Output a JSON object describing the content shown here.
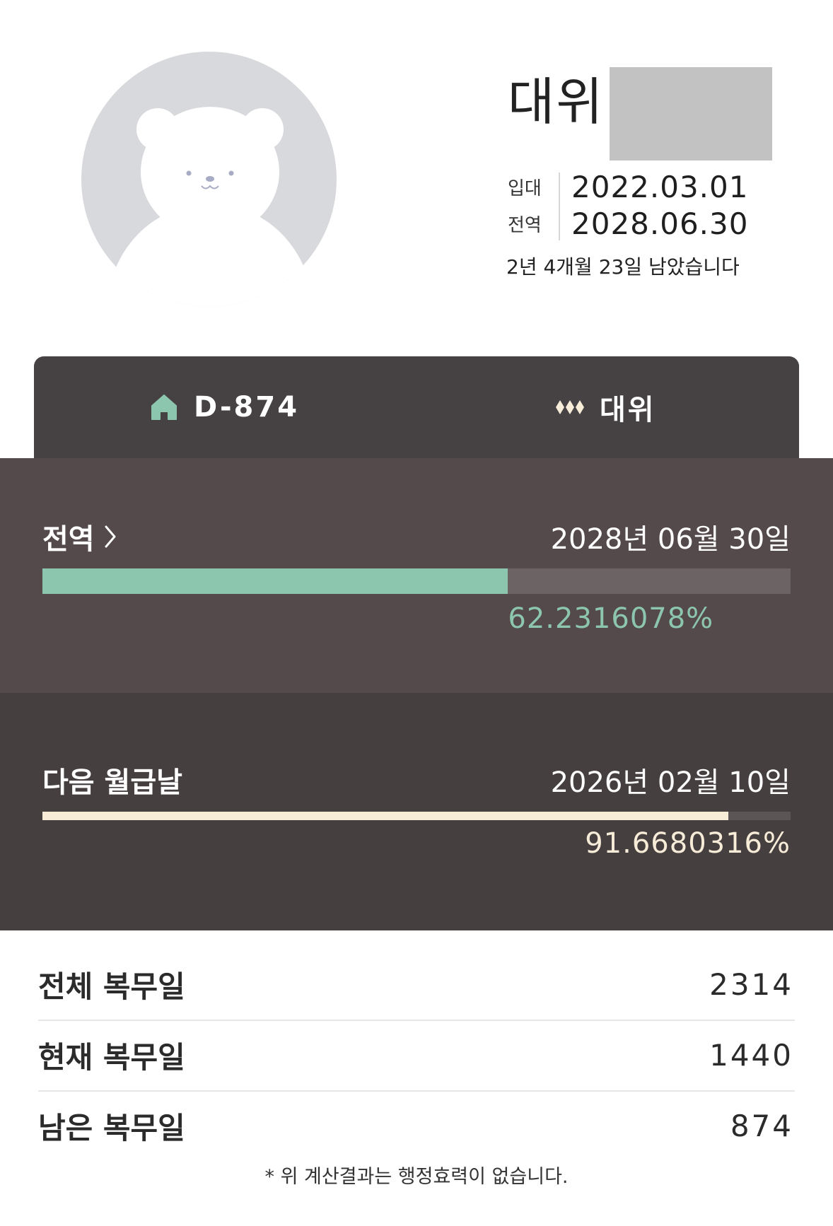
{
  "profile": {
    "rank": "대위",
    "enlist_label": "입대",
    "enlist_date": "2022.03.01",
    "discharge_label": "전역",
    "discharge_date": "2028.06.30",
    "remaining_text": "2년 4개월 23일 남았습니다"
  },
  "tabs": {
    "dday_label": "D-874",
    "rank_label": "대위"
  },
  "discharge_panel": {
    "label": "전역",
    "date": "2028년 06월 30일",
    "progress_percent": 62.2316078,
    "percent_text": "62.2316078%"
  },
  "payday_panel": {
    "label": "다음 월급날",
    "date": "2026년 02월 10일",
    "progress_percent": 91.6680316,
    "percent_text": "91.6680316%"
  },
  "stats": [
    {
      "label": "전체 복무일",
      "value": "2314"
    },
    {
      "label": "현재 복무일",
      "value": "1440"
    },
    {
      "label": "남은 복무일",
      "value": "874"
    }
  ],
  "disclaimer": "* 위 계산결과는 행정효력이 없습니다.",
  "colors": {
    "accent_green": "#8dc6ae",
    "accent_cream": "#f7ecd8",
    "avatar_bg": "#d8d9dd",
    "dark_panel": "#463f40",
    "mid_panel": "#544a4b"
  },
  "icons": {
    "avatar": "bear-avatar-icon",
    "dday": "home-icon",
    "rank": "rank-diamonds-icon",
    "chevron": "chevron-right-icon"
  }
}
